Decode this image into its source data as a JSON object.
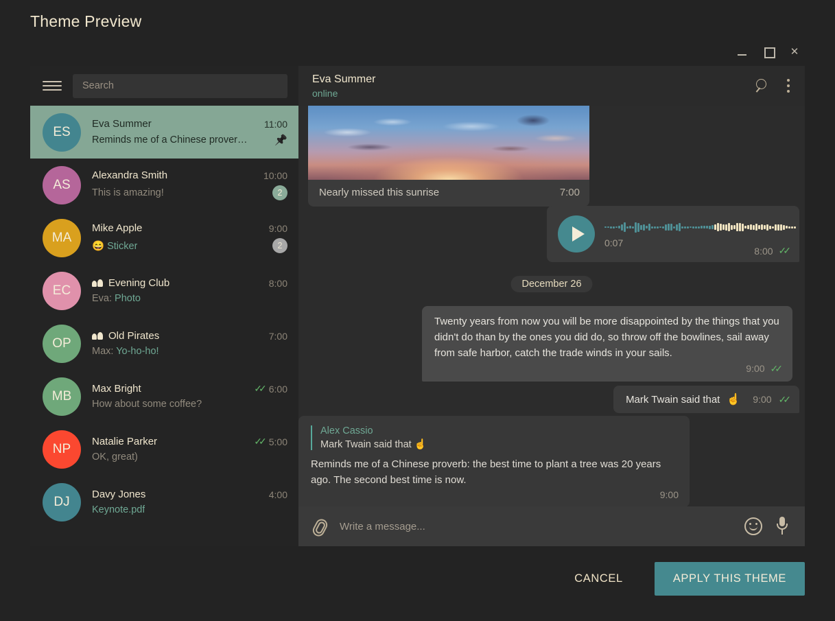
{
  "page_title": "Theme Preview",
  "window_controls": {
    "minimize": "—",
    "maximize": "□",
    "close": "✕"
  },
  "sidebar": {
    "menu_icon": "hamburger-icon",
    "search": {
      "placeholder": "Search",
      "value": ""
    },
    "chats": [
      {
        "initials": "ES",
        "avatar_color": "#43858f",
        "name": "Eva Summer",
        "time": "11:00",
        "message": "Reminds me of a Chinese prover…",
        "selected": true,
        "pinned": true,
        "group": false,
        "badge": null,
        "badge_type": null,
        "ticks": false,
        "sender": null,
        "media": null
      },
      {
        "initials": "AS",
        "avatar_color": "#b5669a",
        "name": "Alexandra Smith",
        "time": "10:00",
        "message": "This is amazing!",
        "selected": false,
        "pinned": false,
        "group": false,
        "badge": "2",
        "badge_type": "unread",
        "ticks": false,
        "sender": null,
        "media": null
      },
      {
        "initials": "MA",
        "avatar_color": "#d9a01e",
        "name": "Mike Apple",
        "time": "9:00",
        "message": "Sticker",
        "emoji": "😄",
        "selected": false,
        "pinned": false,
        "group": false,
        "badge": "2",
        "badge_type": "muted",
        "ticks": false,
        "sender": null,
        "media": "Sticker"
      },
      {
        "initials": "EC",
        "avatar_color": "#e091ab",
        "name": "Evening Club",
        "time": "8:00",
        "message": "Photo",
        "selected": false,
        "pinned": false,
        "group": true,
        "badge": null,
        "badge_type": null,
        "ticks": false,
        "sender": "Eva: ",
        "media": "Photo"
      },
      {
        "initials": "OP",
        "avatar_color": "#6fa87a",
        "name": "Old Pirates",
        "time": "7:00",
        "message": "Yo-ho-ho!",
        "selected": false,
        "pinned": false,
        "group": true,
        "badge": null,
        "badge_type": null,
        "ticks": false,
        "sender": "Max: ",
        "media": "Yo-ho-ho!"
      },
      {
        "initials": "MB",
        "avatar_color": "#6fa87a",
        "name": "Max Bright",
        "time": "6:00",
        "message": "How about some coffee?",
        "selected": false,
        "pinned": false,
        "group": false,
        "badge": null,
        "badge_type": null,
        "ticks": true,
        "sender": null,
        "media": null
      },
      {
        "initials": "NP",
        "avatar_color": "#fb4830",
        "name": "Natalie Parker",
        "time": "5:00",
        "message": "OK, great)",
        "selected": false,
        "pinned": false,
        "group": false,
        "badge": null,
        "badge_type": null,
        "ticks": true,
        "sender": null,
        "media": null
      },
      {
        "initials": "DJ",
        "avatar_color": "#43858f",
        "name": "Davy Jones",
        "time": "4:00",
        "message": "Keynote.pdf",
        "selected": false,
        "pinned": false,
        "group": false,
        "badge": null,
        "badge_type": null,
        "ticks": false,
        "sender": null,
        "media": "Keynote.pdf"
      }
    ]
  },
  "chat": {
    "header": {
      "title": "Eva Summer",
      "status": "online",
      "search_icon": "search-icon",
      "menu_icon": "more-vertical-icon"
    },
    "messages": {
      "photo": {
        "caption": "Nearly missed this sunrise",
        "time": "7:00"
      },
      "voice": {
        "duration": "0:07",
        "time": "8:00",
        "read": true,
        "play_icon": "play-icon"
      },
      "date_divider": "December 26",
      "incoming": {
        "text": "Twenty years from now you will be more disappointed by the things that you didn't do than by the ones you did do, so throw off the bowlines, sail away from safe harbor, catch the trade winds in your sails.",
        "time": "9:00",
        "read": true
      },
      "outgoing": {
        "text": "Mark Twain said that",
        "emoji": "☝",
        "time": "9:00",
        "read": true
      },
      "reply": {
        "quote_name": "Alex Cassio",
        "quote_text": "Mark Twain said that",
        "quote_emoji": "☝",
        "text": "Reminds me of a Chinese proverb: the best time to plant a tree was 20 years ago. The second best time is now.",
        "time": "9:00"
      }
    },
    "composer": {
      "attach_icon": "paperclip-icon",
      "placeholder": "Write a message...",
      "value": "",
      "emoji_icon": "smiley-icon",
      "mic_icon": "microphone-icon"
    }
  },
  "footer": {
    "cancel_label": "CANCEL",
    "apply_label": "APPLY THIS THEME"
  },
  "colors": {
    "accent": "#45898f",
    "selected_row": "#85a795",
    "title_text": "#f0e6cd",
    "online_text": "#6fa894",
    "tick_green": "#62b368",
    "window_bg": "#232323",
    "sidebar_bg": "#242424",
    "chat_bg": "#2c2c2c"
  },
  "waveform": {
    "played_color": "#4f9096",
    "unplayed_color": "#f0e3c0",
    "played_count": 40,
    "heights": [
      2,
      2,
      3,
      3,
      2,
      4,
      9,
      14,
      3,
      4,
      3,
      15,
      13,
      7,
      9,
      4,
      10,
      3,
      3,
      3,
      2,
      3,
      9,
      10,
      10,
      3,
      9,
      12,
      3,
      3,
      3,
      2,
      3,
      3,
      3,
      4,
      4,
      4,
      5,
      6,
      8,
      12,
      10,
      8,
      9,
      12,
      7,
      6,
      12,
      12,
      11,
      4,
      6,
      8,
      7,
      10,
      6,
      8,
      6,
      9,
      5,
      3,
      9,
      9,
      9,
      7,
      4,
      3,
      3,
      3
    ]
  }
}
